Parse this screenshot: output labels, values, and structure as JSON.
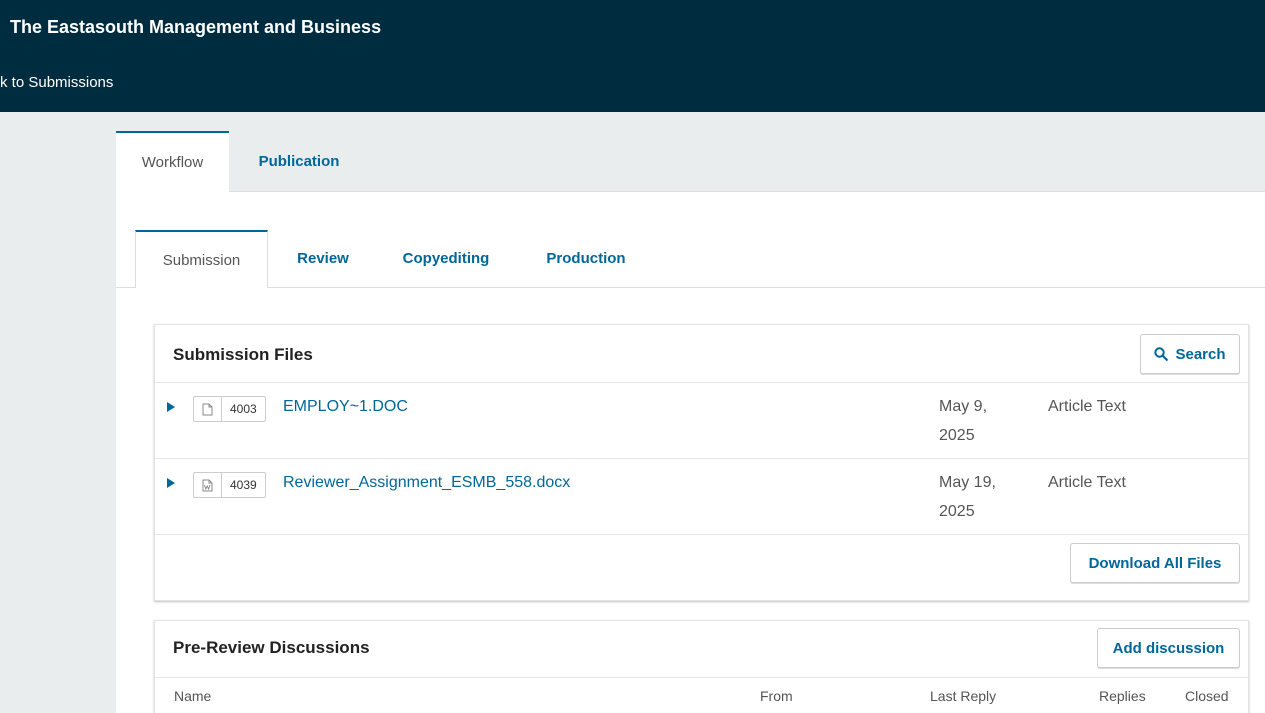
{
  "header": {
    "journal_title": "The Eastasouth Management and Business",
    "back_link": "k to Submissions"
  },
  "main_tabs": [
    {
      "label": "Workflow",
      "active": true
    },
    {
      "label": "Publication",
      "active": false
    }
  ],
  "stage_tabs": [
    {
      "label": "Submission",
      "active": true
    },
    {
      "label": "Review",
      "active": false
    },
    {
      "label": "Copyediting",
      "active": false
    },
    {
      "label": "Production",
      "active": false
    }
  ],
  "submission_files": {
    "title": "Submission Files",
    "search_label": "Search",
    "download_all_label": "Download All Files",
    "files": [
      {
        "id": "4003",
        "name": "EMPLOY~1.DOC",
        "date_line1": "May 9,",
        "date_line2": "2025",
        "genre": "Article Text",
        "icon": "generic-file-icon"
      },
      {
        "id": "4039",
        "name": "Reviewer_Assignment_ESMB_558.docx",
        "date_line1": "May 19,",
        "date_line2": "2025",
        "genre": "Article Text",
        "icon": "word-file-icon"
      }
    ]
  },
  "discussions": {
    "title": "Pre-Review Discussions",
    "add_label": "Add discussion",
    "columns": [
      "Name",
      "From",
      "Last Reply",
      "Replies",
      "Closed"
    ]
  },
  "colors": {
    "header_bg": "#002c40",
    "link": "#006798"
  }
}
